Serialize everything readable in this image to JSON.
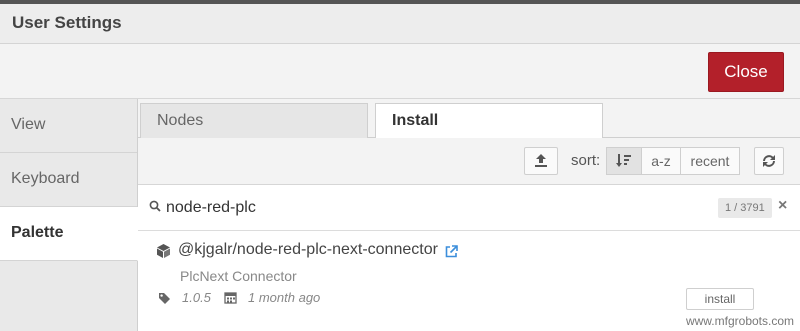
{
  "dialog": {
    "title": "User Settings",
    "close_label": "Close"
  },
  "sidebar": {
    "items": [
      {
        "label": "View"
      },
      {
        "label": "Keyboard"
      },
      {
        "label": "Palette"
      }
    ]
  },
  "tabs": [
    {
      "label": "Nodes"
    },
    {
      "label": "Install"
    }
  ],
  "install": {
    "sort_label": "sort:",
    "sort_options": [
      "a-z",
      "recent"
    ],
    "search_value": "node-red-plc",
    "count": "1 / 3791",
    "clear": "×",
    "result": {
      "name": "@kjgalr/node-red-plc-next-connector",
      "description": "PlcNext Connector",
      "version": "1.0.5",
      "updated": "1 month ago",
      "install_label": "install"
    }
  },
  "watermark": "www.mfgrobots.com",
  "colors": {
    "close_button": "#b3202a",
    "active_panel": "#ffffff"
  },
  "icons": [
    "upload-icon",
    "sort-relevance-icon",
    "refresh-icon",
    "search-icon",
    "package-icon",
    "external-link-icon",
    "tag-icon",
    "calendar-icon"
  ]
}
